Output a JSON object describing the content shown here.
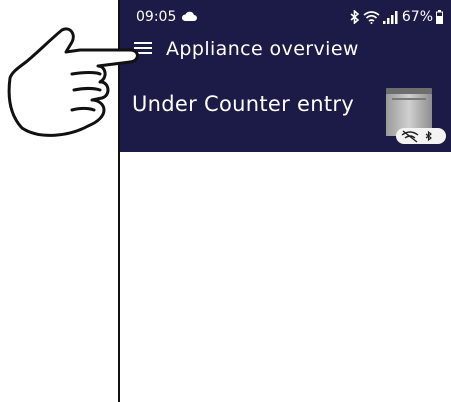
{
  "status_bar": {
    "time": "09:05",
    "battery_percent": "67%",
    "icons": [
      "cloud-icon",
      "bluetooth-icon",
      "wifi-icon",
      "signal-icon",
      "battery-icon"
    ]
  },
  "header": {
    "menu_icon": "hamburger-menu-icon",
    "title": "Appliance overview",
    "background": "#1c1a46"
  },
  "appliance": {
    "name": "Under Counter entry",
    "image": "dishwasher-icon",
    "connection_status_icons": [
      "wifi-off-icon",
      "bluetooth-icon"
    ]
  },
  "overlay": {
    "icon": "pointing-hand-icon"
  }
}
